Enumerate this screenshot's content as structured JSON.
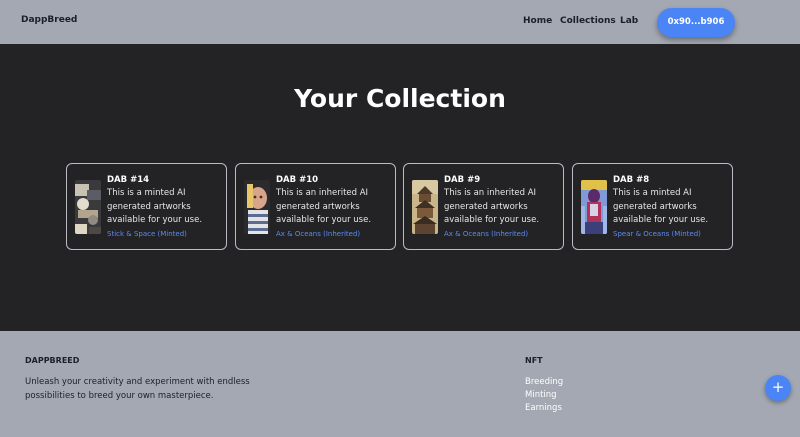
{
  "header": {
    "brand": "DappBreed",
    "nav": [
      "Home",
      "Collections",
      "Lab"
    ],
    "wallet": "0x90...b906"
  },
  "main": {
    "title": "Your Collection",
    "cards": [
      {
        "title": "DAB #14",
        "description": "This is a minted AI generated artworks available for your use.",
        "tag": "Stick & Space (Minted)",
        "image": "space-collage"
      },
      {
        "title": "DAB #10",
        "description": "This is an inherited AI generated artworks available for your use.",
        "tag": "Ax & Oceans (Inherited)",
        "image": "portrait"
      },
      {
        "title": "DAB #9",
        "description": "This is an inherited AI generated artworks available for your use.",
        "tag": "Ax & Oceans (Inherited)",
        "image": "tower"
      },
      {
        "title": "DAB #8",
        "description": "This is a minted AI generated artworks available for your use.",
        "tag": "Spear & Oceans (Minted)",
        "image": "figure"
      }
    ]
  },
  "footer": {
    "brand": "DAPPBREED",
    "text": "Unleash your creativity and experiment with endless possibilities to breed your own masterpiece.",
    "nft_heading": "NFT",
    "links": [
      "Breeding",
      "Minting",
      "Earnings"
    ]
  },
  "fab": {
    "icon": "plus-icon",
    "label": "+"
  },
  "colors": {
    "accent": "#4a84f5",
    "background": "#232325",
    "chrome": "#a3a8b3",
    "tag": "#5a8bf5"
  }
}
